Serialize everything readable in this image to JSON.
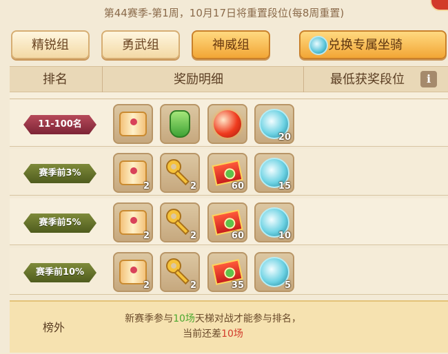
{
  "season_info": "第44赛季-第1周，10月17日将重置段位(每8周重置)",
  "tabs": [
    "精锐组",
    "勇武组",
    "神威组"
  ],
  "active_tab": 2,
  "exchange_button": "兑换专属坐骑",
  "header": {
    "rank": "排名",
    "rewards": "奖励明细",
    "min_tier": "最低获奖段位",
    "info_glyph": "i"
  },
  "rows": [
    {
      "rank": "11-100名",
      "badge_color": "#9a3346",
      "items": [
        {
          "icon": "scroll-icon",
          "qty": ""
        },
        {
          "icon": "potion-bottle-icon",
          "qty": ""
        },
        {
          "icon": "fire-orb-icon",
          "qty": ""
        },
        {
          "icon": "crystal-orb-icon",
          "qty": "20"
        }
      ]
    },
    {
      "rank": "赛季前3%",
      "badge_color": "#66732c",
      "items": [
        {
          "icon": "scroll-icon",
          "qty": "2"
        },
        {
          "icon": "golden-key-icon",
          "qty": "2"
        },
        {
          "icon": "red-ticket-icon",
          "qty": "60"
        },
        {
          "icon": "crystal-orb-icon",
          "qty": "15"
        }
      ]
    },
    {
      "rank": "赛季前5%",
      "badge_color": "#66732c",
      "items": [
        {
          "icon": "scroll-icon",
          "qty": "2"
        },
        {
          "icon": "golden-key-icon",
          "qty": "2"
        },
        {
          "icon": "red-ticket-icon",
          "qty": "60"
        },
        {
          "icon": "crystal-orb-icon",
          "qty": "10"
        }
      ]
    },
    {
      "rank": "赛季前10%",
      "badge_color": "#66732c",
      "items": [
        {
          "icon": "scroll-icon",
          "qty": "2"
        },
        {
          "icon": "golden-key-icon",
          "qty": "2"
        },
        {
          "icon": "red-ticket-icon",
          "qty": "35"
        },
        {
          "icon": "crystal-orb-icon",
          "qty": "5"
        }
      ]
    }
  ],
  "footer": {
    "label": "榜外",
    "msg_part1": "新赛季参与",
    "msg_count1": "10场",
    "msg_part2": "天梯对战才能参与排名，",
    "msg_part3": "当前还差",
    "msg_count2": "10场",
    "highlight_green": "#4ba82f",
    "highlight_red": "#d23a2a"
  }
}
